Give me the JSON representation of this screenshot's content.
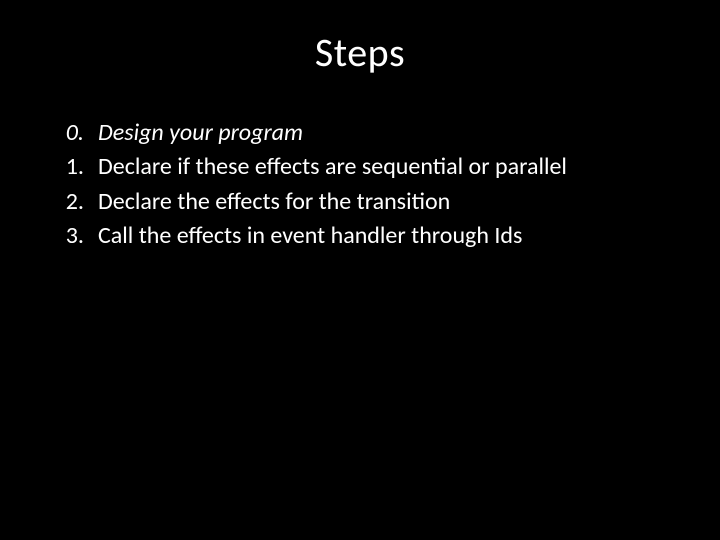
{
  "title": "Steps",
  "items": [
    {
      "marker": "0.",
      "text": "Design your program",
      "italic": true
    },
    {
      "marker": "1.",
      "text": "Declare if these effects are sequential or parallel",
      "italic": false
    },
    {
      "marker": "2.",
      "text": "Declare the effects for the transition",
      "italic": false
    },
    {
      "marker": "3.",
      "text": "Call the effects in event handler through Ids",
      "italic": false
    }
  ]
}
